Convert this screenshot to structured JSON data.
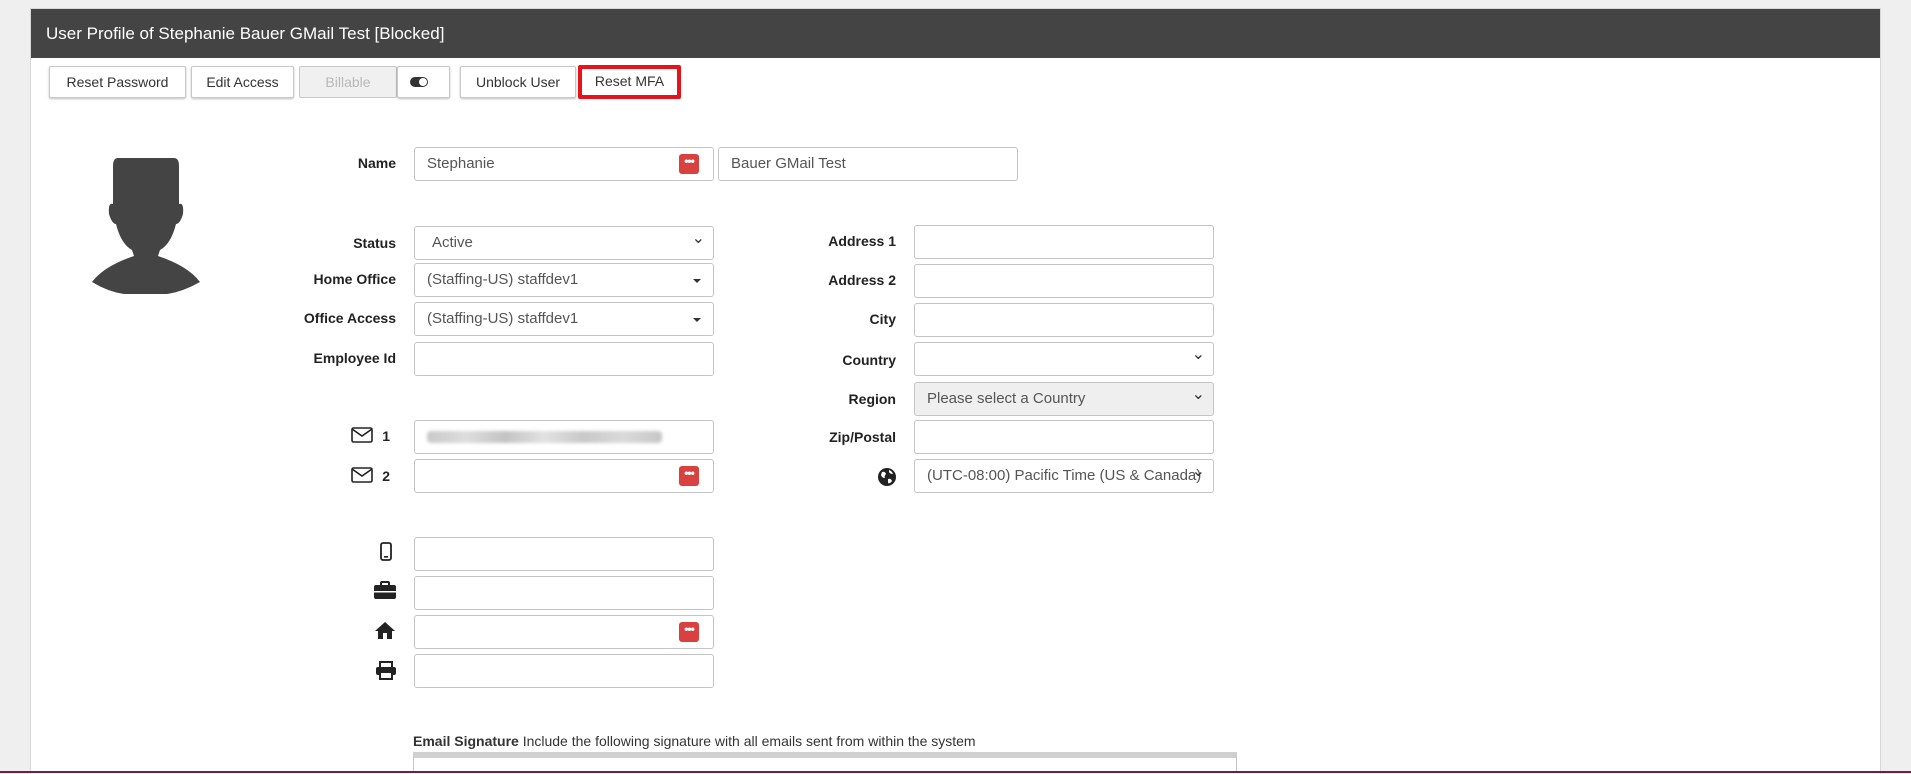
{
  "header": {
    "title": "User Profile of Stephanie Bauer GMail Test [Blocked]"
  },
  "toolbar": {
    "reset_password": "Reset Password",
    "edit_access": "Edit Access",
    "billable": "Billable",
    "unblock_user": "Unblock User",
    "reset_mfa": "Reset MFA"
  },
  "form": {
    "name_label": "Name",
    "first_name": "Stephanie",
    "last_name": "Bauer GMail Test",
    "status_label": "Status",
    "status_value": "Active",
    "home_office_label": "Home Office",
    "home_office_value": "(Staffing-US) staffdev1",
    "office_access_label": "Office Access",
    "office_access_value": "(Staffing-US) staffdev1",
    "employee_id_label": "Employee Id",
    "employee_id_value": "",
    "email1_num": "1",
    "email2_num": "2",
    "email2_value": "",
    "mobile_value": "",
    "work_phone_value": "",
    "home_phone_value": "",
    "fax_value": "",
    "address1_label": "Address 1",
    "address1_value": "",
    "address2_label": "Address 2",
    "address2_value": "",
    "city_label": "City",
    "city_value": "",
    "country_label": "Country",
    "country_value": "",
    "region_label": "Region",
    "region_value": "Please select a Country",
    "zip_label": "Zip/Postal",
    "zip_value": "",
    "timezone_value": "(UTC-08:00) Pacific Time (US & Canada)"
  },
  "signature": {
    "title": "Email Signature",
    "description": "Include the following signature with all emails sent from within the system"
  },
  "icons": {
    "avatar": "user-silhouette",
    "email": "envelope-icon",
    "mobile": "mobile-phone-icon",
    "work": "briefcase-icon",
    "home": "home-icon",
    "fax": "printer-icon",
    "timezone": "globe-icon",
    "password_manager": "dots-icon"
  },
  "colors": {
    "header_bg": "#444444",
    "highlight": "#e8121b",
    "dots": "#d94141"
  }
}
